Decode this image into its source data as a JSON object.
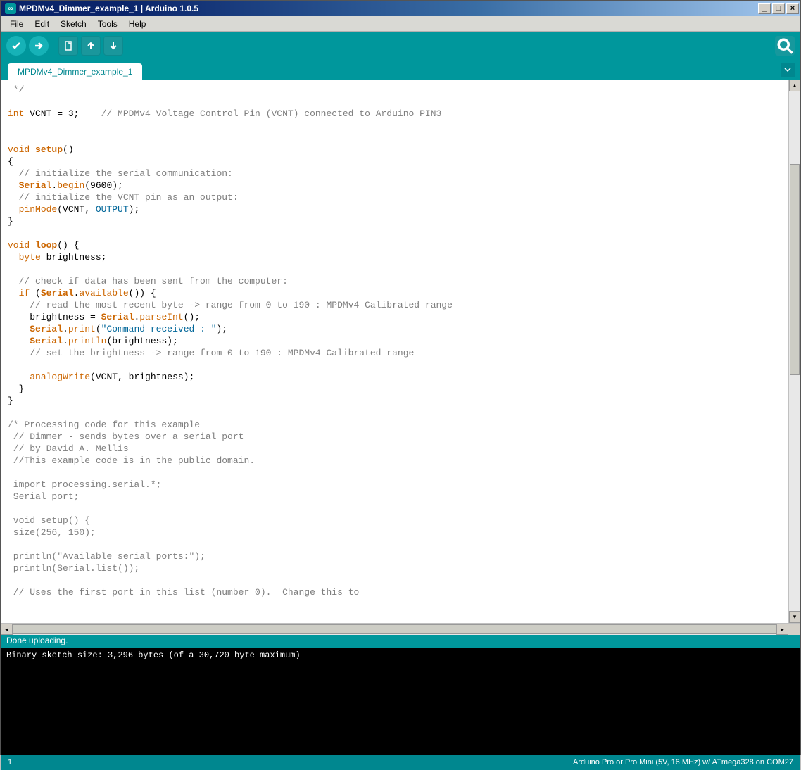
{
  "window": {
    "title": "MPDMv4_Dimmer_example_1 | Arduino 1.0.5"
  },
  "menu": {
    "items": [
      "File",
      "Edit",
      "Sketch",
      "Tools",
      "Help"
    ]
  },
  "toolbar": {
    "verify_tooltip": "Verify",
    "upload_tooltip": "Upload",
    "new_tooltip": "New",
    "open_tooltip": "Open",
    "save_tooltip": "Save",
    "serial_monitor_tooltip": "Serial Monitor"
  },
  "tabs": {
    "active": "MPDMv4_Dimmer_example_1"
  },
  "code": {
    "line1": " */",
    "line2": "",
    "line3_kw": "int",
    "line3_var": " VCNT = 3;    ",
    "line3_cmt": "// MPDMv4 Voltage Control Pin (VCNT) connected to Arduino PIN3",
    "line4": "",
    "line5": "",
    "line6_kw": "void",
    "line6_fn": " setup",
    "line6_rest": "()",
    "line7": "{",
    "line8_cmt": "  // initialize the serial communication:",
    "line9_a": "  ",
    "line9_cls": "Serial",
    "line9_b": ".",
    "line9_mth": "begin",
    "line9_c": "(9600);",
    "line10_cmt": "  // initialize the VCNT pin as an output:",
    "line11_a": "  ",
    "line11_mth": "pinMode",
    "line11_b": "(VCNT, ",
    "line11_con": "OUTPUT",
    "line11_c": ");",
    "line12": "}",
    "line13": "",
    "line14_kw": "void",
    "line14_fn": " loop",
    "line14_rest": "() {",
    "line15_a": "  ",
    "line15_typ": "byte",
    "line15_b": " brightness;",
    "line16": "",
    "line17_cmt": "  // check if data has been sent from the computer:",
    "line18_a": "  ",
    "line18_kw": "if",
    "line18_b": " (",
    "line18_cls": "Serial",
    "line18_c": ".",
    "line18_mth": "available",
    "line18_d": "()) {",
    "line19_cmt": "    // read the most recent byte -> range from 0 to 190 : MPDMv4 Calibrated range",
    "line20_a": "    brightness = ",
    "line20_cls": "Serial",
    "line20_b": ".",
    "line20_mth": "parseInt",
    "line20_c": "();",
    "line21_a": "    ",
    "line21_cls": "Serial",
    "line21_b": ".",
    "line21_mth": "print",
    "line21_c": "(",
    "line21_str": "\"Command received : \"",
    "line21_d": ");",
    "line22_a": "    ",
    "line22_cls": "Serial",
    "line22_b": ".",
    "line22_mth": "println",
    "line22_c": "(brightness);",
    "line23_cmt": "    // set the brightness -> range from 0 to 190 : MPDMv4 Calibrated range",
    "line24": "",
    "line25_a": "    ",
    "line25_mth": "analogWrite",
    "line25_b": "(VCNT, brightness);",
    "line26": "  }",
    "line27": "}",
    "line28": "",
    "line29_cmt": "/* Processing code for this example",
    "line30_cmt": " // Dimmer - sends bytes over a serial port",
    "line31_cmt": " // by David A. Mellis",
    "line32_cmt": " //This example code is in the public domain.",
    "line33_cmt": " ",
    "line34_cmt": " import processing.serial.*;",
    "line35_cmt": " Serial port;",
    "line36_cmt": " ",
    "line37_cmt": " void setup() {",
    "line38_cmt": " size(256, 150);",
    "line39_cmt": " ",
    "line40_cmt": " println(\"Available serial ports:\");",
    "line41_cmt": " println(Serial.list());",
    "line42_cmt": " ",
    "line43_cmt": " // Uses the first port in this list (number 0).  Change this to"
  },
  "status": {
    "message": "Done uploading."
  },
  "console": {
    "line1": "Binary sketch size: 3,296 bytes (of a 30,720 byte maximum)"
  },
  "bottombar": {
    "line_number": "1",
    "board_info": "Arduino Pro or Pro Mini (5V, 16 MHz) w/ ATmega328 on COM27"
  }
}
